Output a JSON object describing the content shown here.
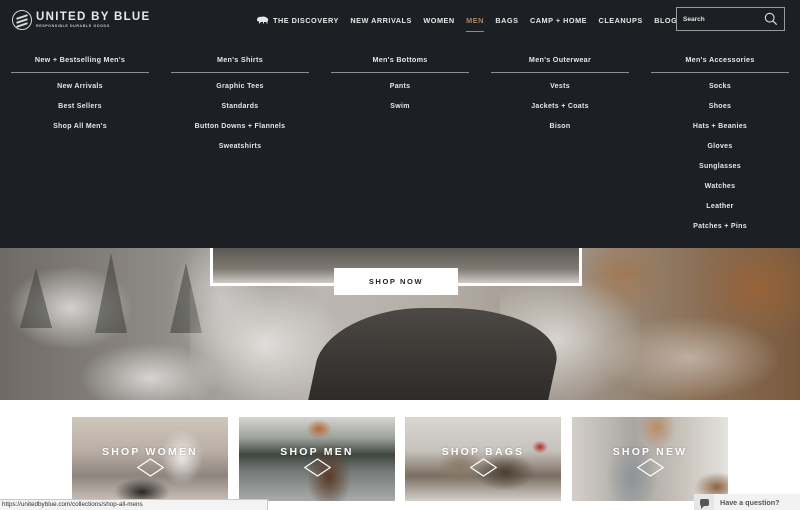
{
  "brand": {
    "name": "UNITED BY BLUE",
    "tagline": "RESPONSIBLE DURABLE GOODS"
  },
  "nav": {
    "items": [
      {
        "label": "THE DISCOVERY",
        "icon": "bison-icon",
        "active": false
      },
      {
        "label": "NEW ARRIVALS",
        "active": false
      },
      {
        "label": "WOMEN",
        "active": false
      },
      {
        "label": "MEN",
        "active": true
      },
      {
        "label": "BAGS",
        "active": false
      },
      {
        "label": "CAMP + HOME",
        "active": false
      },
      {
        "label": "CLEANUPS",
        "active": false
      },
      {
        "label": "BLOG",
        "active": false
      }
    ],
    "active_color": "#a78667"
  },
  "search": {
    "placeholder": "Search",
    "value": "",
    "icon": "search-icon"
  },
  "mega_menu": {
    "columns": [
      {
        "heading": "New + Bestselling Men's",
        "items": [
          "New Arrivals",
          "Best Sellers",
          "Shop All Men's"
        ]
      },
      {
        "heading": "Men's Shirts",
        "items": [
          "Graphic Tees",
          "Standards",
          "Button Downs + Flannels",
          "Sweatshirts"
        ]
      },
      {
        "heading": "Men's Bottoms",
        "items": [
          "Pants",
          "Swim"
        ]
      },
      {
        "heading": "Men's Outerwear",
        "items": [
          "Vests",
          "Jackets + Coats",
          "Bison"
        ]
      },
      {
        "heading": "Men's Accessories",
        "items": [
          "Socks",
          "Shoes",
          "Hats + Beanies",
          "Gloves",
          "Sunglasses",
          "Watches",
          "Leather",
          "Patches + Pins"
        ]
      }
    ]
  },
  "hero": {
    "cta_label": "SHOP NOW"
  },
  "tiles": [
    {
      "label": "SHOP WOMEN"
    },
    {
      "label": "SHOP MEN"
    },
    {
      "label": "SHOP BAGS"
    },
    {
      "label": "SHOP NEW"
    }
  ],
  "status_bar": {
    "url": "https://unitedbyblue.com/collections/shop-all-mens"
  },
  "chat": {
    "label": "Have a question?",
    "icon": "chat-bubble-icon"
  },
  "colors": {
    "header_bg": "#1c1f24",
    "accent": "#a78667"
  }
}
